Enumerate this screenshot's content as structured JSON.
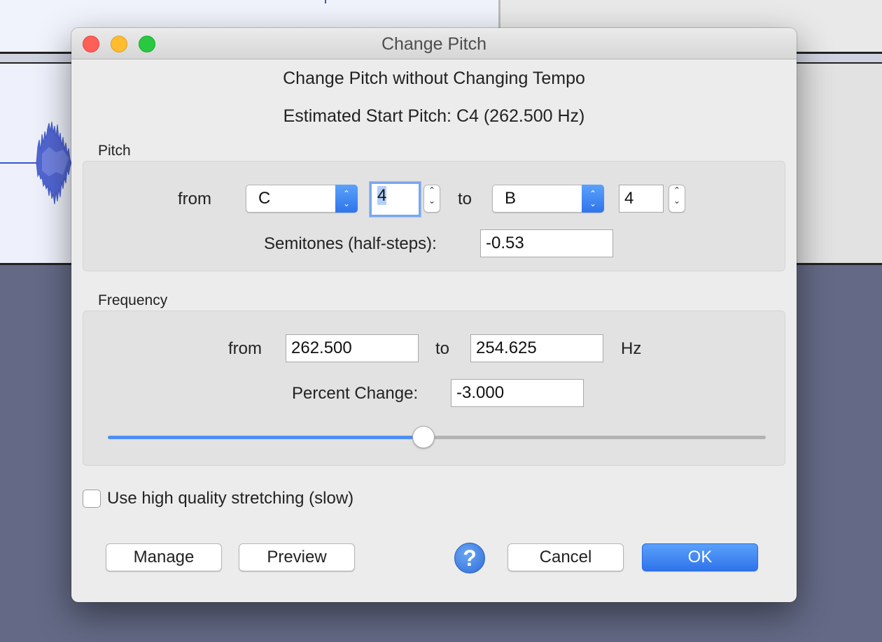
{
  "dialog": {
    "title": "Change Pitch",
    "heading": "Change Pitch without Changing Tempo",
    "estimated_start": "Estimated Start Pitch: C4 (262.500 Hz)"
  },
  "pitch": {
    "group_label": "Pitch",
    "from_label": "from",
    "from_note": "C",
    "from_octave": "4",
    "to_label": "to",
    "to_note": "B",
    "to_octave": "4",
    "semitones_label": "Semitones (half-steps):",
    "semitones_value": "-0.53"
  },
  "frequency": {
    "group_label": "Frequency",
    "from_label": "from",
    "from_value": "262.500",
    "to_label": "to",
    "to_value": "254.625",
    "unit": "Hz",
    "percent_label": "Percent Change:",
    "percent_value": "-3.000",
    "slider_fraction": 0.48
  },
  "options": {
    "high_quality_label": "Use high quality stretching (slow)",
    "high_quality_checked": false
  },
  "buttons": {
    "manage": "Manage",
    "preview": "Preview",
    "help": "?",
    "cancel": "Cancel",
    "ok": "OK"
  },
  "colors": {
    "accent": "#2f74ea",
    "waveform": "#3d55c8",
    "close": "#fe5f57",
    "minimize": "#febc2e",
    "maximize": "#28c840"
  }
}
